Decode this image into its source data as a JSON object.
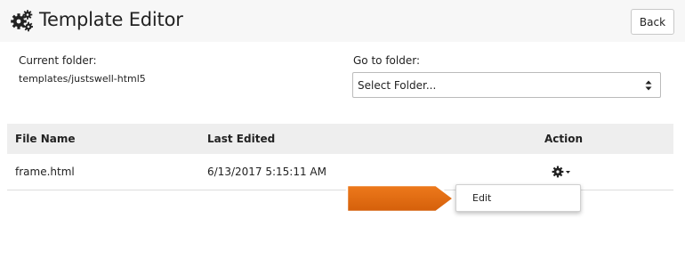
{
  "header": {
    "title": "Template Editor",
    "icon": "gears-icon",
    "back_label": "Back"
  },
  "folder": {
    "current_label": "Current folder:",
    "current_value": "templates/justswell-html5",
    "goto_label": "Go to folder:",
    "select_value": "Select Folder..."
  },
  "table": {
    "columns": [
      "File Name",
      "Last Edited",
      "Action"
    ],
    "rows": [
      {
        "file_name": "frame.html",
        "last_edited": "6/13/2017 5:15:11 AM",
        "action_icon": "gear-icon"
      }
    ]
  },
  "menu": {
    "items": [
      "Edit"
    ]
  },
  "colors": {
    "header_bg": "#f7f7f7",
    "table_header_bg": "#eeeeee",
    "callout_orange": "#e06a10"
  }
}
